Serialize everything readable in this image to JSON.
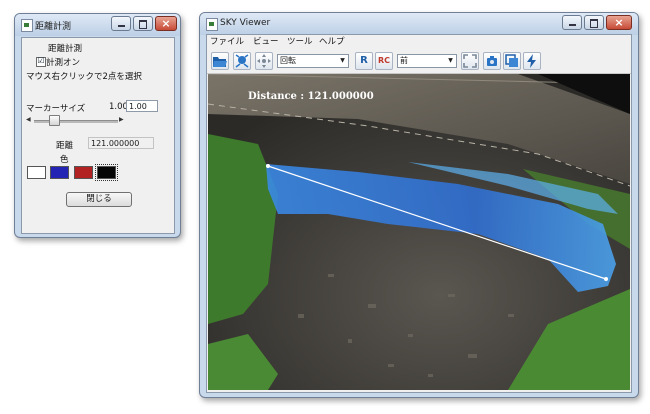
{
  "dialog": {
    "title": "距離計測",
    "header_label": "距離計測",
    "measure_on_label": "計測オン",
    "measure_on_checked": "☑",
    "instruction": "マウス右クリックで2点を選択",
    "marker_size_label": "マーカーサイズ",
    "marker_size_value": "1.00",
    "marker_size_input": "1.00",
    "marker_size_slider_level": 0.2,
    "distance_label": "距離",
    "distance_value": "121.000000",
    "color_label": "色",
    "colors": [
      "#ffffff",
      "#2323b4",
      "#b22222",
      "#050505"
    ],
    "close_button": "閉じる"
  },
  "viewer": {
    "title": "SKY Viewer",
    "menu": [
      "ファイル",
      "ビュー",
      "ツール",
      "ヘルプ"
    ],
    "rotate_mode": "回転",
    "view_direction": "前",
    "toolbar_icons": {
      "open": "folder-open-icon",
      "fit": "fit-view-icon",
      "pan": "pan-icon",
      "reset_rotation": "R",
      "rc": "RC",
      "fullscreen": "fullscreen-icon",
      "camera": "camera-icon",
      "copy": "copy-icon",
      "lightning": "lightning-icon"
    },
    "distance_overlay": "Distance : 121.000000"
  },
  "colors": {
    "title_gradient_top": "#dfe9f6",
    "close_button": "#c64a36",
    "measure_line": "#ffffff",
    "highlight_region": "#2f7be0"
  }
}
